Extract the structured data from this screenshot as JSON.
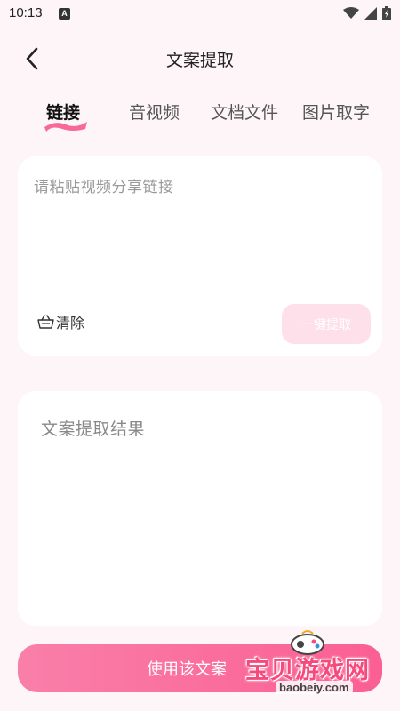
{
  "status_bar": {
    "time": "10:13",
    "notification_badge": "A"
  },
  "header": {
    "title": "文案提取",
    "back_icon": "chevron-left-icon"
  },
  "tabs": [
    {
      "label": "链接",
      "active": true
    },
    {
      "label": "音视频",
      "active": false
    },
    {
      "label": "文档文件",
      "active": false
    },
    {
      "label": "图片取字",
      "active": false
    }
  ],
  "input_card": {
    "placeholder": "请粘贴视频分享链接",
    "clear_label": "清除",
    "clear_icon": "basket-icon",
    "extract_label": "一键提取"
  },
  "result_card": {
    "placeholder": "文案提取结果"
  },
  "use_button": {
    "label": "使用该文案"
  },
  "watermark": {
    "text": "宝贝游戏网",
    "url": "baobeiy.com"
  },
  "colors": {
    "accent": "#fb5f93",
    "background": "#fdf5f8",
    "extract_disabled": "#fde0ea"
  }
}
